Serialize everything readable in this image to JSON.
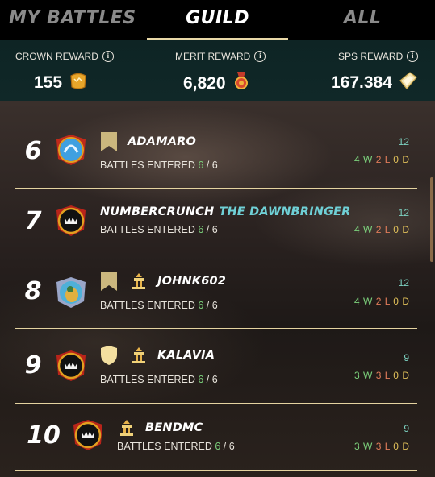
{
  "tabs": [
    {
      "label": "MY BATTLES",
      "active": false
    },
    {
      "label": "GUILD",
      "active": true
    },
    {
      "label": "ALL",
      "active": false
    }
  ],
  "rewards": {
    "crown": {
      "label": "CROWN REWARD",
      "value": "155",
      "icon": "crown-token-icon"
    },
    "merit": {
      "label": "MERIT REWARD",
      "value": "6,820",
      "icon": "merit-medal-icon"
    },
    "sps": {
      "label": "SPS REWARD",
      "value": "167.384",
      "icon": "sps-token-icon"
    }
  },
  "colors": {
    "tab_underline": "#e9d9a8",
    "rewards_bg": "#102828",
    "row_divider": "#e4d3a0",
    "wins": "#7cd17c",
    "losses": "#e07c5a",
    "draws": "#e0c05a",
    "score": "#7cd1c0",
    "title": "#6fd0d6"
  },
  "rows": [
    {
      "rank": "6",
      "name": "ADAMARO",
      "title": "",
      "entered_label": "BATTLES ENTERED",
      "entered": "6",
      "total": "/ 6",
      "score": "12",
      "w": "4",
      "l": "2",
      "d": "0"
    },
    {
      "rank": "7",
      "name": "NUMBERCRUNCH",
      "title": "THE DAWNBRINGER",
      "entered_label": "BATTLES ENTERED",
      "entered": "6",
      "total": "/ 6",
      "score": "12",
      "w": "4",
      "l": "2",
      "d": "0"
    },
    {
      "rank": "8",
      "name": "JOHNK602",
      "title": "",
      "entered_label": "BATTLES ENTERED",
      "entered": "6",
      "total": "/ 6",
      "score": "12",
      "w": "4",
      "l": "2",
      "d": "0"
    },
    {
      "rank": "9",
      "name": "KALAVIA",
      "title": "",
      "entered_label": "BATTLES ENTERED",
      "entered": "6",
      "total": "/ 6",
      "score": "9",
      "w": "3",
      "l": "3",
      "d": "0"
    },
    {
      "rank": "10",
      "name": "BENDMC",
      "title": "",
      "entered_label": "BATTLES ENTERED",
      "entered": "6",
      "total": "/ 6",
      "score": "9",
      "w": "3",
      "l": "3",
      "d": "0"
    }
  ],
  "record_letters": {
    "w": "W",
    "l": "L",
    "d": "D"
  }
}
